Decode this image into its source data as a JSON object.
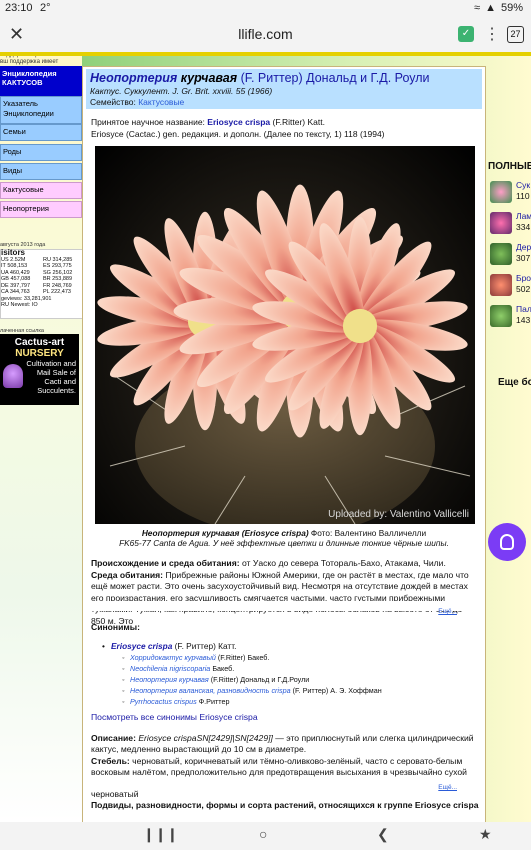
{
  "status": {
    "time": "23:10",
    "temp": "2°",
    "battery": "59%"
  },
  "browser": {
    "url": "llifle.com",
    "tab_count": "27",
    "close_icon": "close-icon",
    "menu_icon": "more-vert-icon"
  },
  "sidebar": {
    "support_text": "поддержка проекта Сеть ЕС вш поддержка имеет решающее",
    "encyclopedia": "Энциклопедия КАКТУСОВ",
    "nav": [
      {
        "label": "Указатель Энциклопедии",
        "style": "blue"
      },
      {
        "label": "Семьи",
        "style": "blue"
      },
      {
        "label": "Роды",
        "style": "blue"
      },
      {
        "label": "Виды",
        "style": "blue"
      },
      {
        "label": "Кактусовые",
        "style": "pink"
      },
      {
        "label": "Неопортерия",
        "style": "pink"
      }
    ],
    "visits_date": "августа 2013 года",
    "visitors_title": "isitors",
    "visitor_rows": [
      [
        "US 2.52M",
        "RU 314,285"
      ],
      [
        "IT 508,153",
        "ES 293,775"
      ],
      [
        "UA 460,429",
        "SG 256,102"
      ],
      [
        "GB 457,088",
        "BR 253,889"
      ],
      [
        "DE 397,797",
        "FR 248,769"
      ],
      [
        "CA 344,763",
        "PL 222,473"
      ]
    ],
    "pageviews": "geviews: 33,281,901",
    "flags_line": "RU  Newest:  IO",
    "ad_label": "лаченная ссылка",
    "ad": {
      "line1": "Cactus-art",
      "line2": "NURSERY",
      "line3": "Cultivation and Mail Sale of Cacti and Succulents."
    }
  },
  "article": {
    "title_genus": "Неопортерия",
    "title_species": "курчавая",
    "title_authority": "(F. Риттер) Дональд и Г.Д. Роули",
    "subtitle": "Кактус. Суккулент. J. Gr. Brit. xxviii. 55 (1966)",
    "family_label": "Семейство:",
    "family_link": "Кактусовые",
    "accepted_label": "Принятое научное название:",
    "accepted_name": "Eriosyce crispa",
    "accepted_author": "(F.Ritter) Katt.",
    "accepted_ref": "Eriosyce (Cactac.) gen. редакция. и дополн. (Далее по тексту, 1) 118 (1994)",
    "photo_credit": "Uploaded by: Valentino Vallicelli",
    "caption_name": "Неопортерия курчавая (Eriosyce crispa)",
    "caption_photo": "Фото: Валентино Валличелли",
    "caption_line2": "FK65-77 Canta de Agua. У неё эффектные цветки и длинные тонкие чёрные шипы.",
    "origin_label": "Происхождение и среда обитания:",
    "origin_text": "от Уаско до севера Тотораль-Бахо, Атакама, Чили.",
    "habitat_label": "Среда обитания:",
    "habitat_text": "Прибрежные районы Южной Америки, где он растёт в местах, где мало что ещё может расти. Это очень засухоустойчивый вид. Несмотря на отсутствие дождей в местах его произрастания, его засушливость смягчается частыми, часто густыми прибрежными туманами. Туман, как правило, концентрируется в виде полосы облаков на высоте от 500 до 850 м. Это",
    "more_label": "Ещё...",
    "synonyms_label": "Синонимы:",
    "synonym_main": "Eriosyce crispa",
    "synonym_main_author": "(F. Риттер) Катт.",
    "sub_synonyms": [
      {
        "name": "Хорридокактус курчавый",
        "author": "(F.Ritter) Бакеб."
      },
      {
        "name": "Neochilenia nigriscoparia",
        "author": "Бакеб."
      },
      {
        "name": "Неопортерия курчавая",
        "author": "(F.Ritter) Дональд и Г.Д.Роули"
      },
      {
        "name": "Неопортерия валанская, разновидность crispa",
        "author": "(F. Риттер) А. Э. Хоффман"
      },
      {
        "name": "Pyrrhocactus crispus",
        "author": "Ф.Риттер"
      }
    ],
    "all_synonyms_link": "Посмотреть все синонимы Eriosyce crispa",
    "desc_label": "Описание:",
    "desc_name": "Eriosyce crispaSN[2429]|SN[2429]]",
    "desc_text": "— это приплюснутый или слегка цилиндрический кактус, медленно вырастающий до 10 см в диаметре.",
    "stem_label": "Стебель:",
    "stem_text": "черноватый, коричневатый или тёмно-оливково-зелёный, часто с серовато-белым восковым налётом, предположительно для предотвращения высыхания в чрезвычайно сухой среде. При выращивании белый восковой налёт часто не образуется, стебель коричневатый/черноватый",
    "subspecies_heading": "Подвиды, разновидности, формы и сорта растений, относящихся к группе Eriosyce crispa"
  },
  "rightcol": {
    "title": "ПОЛНЫЕ",
    "items": [
      {
        "name": "Сук",
        "count": "110"
      },
      {
        "name": "Лам",
        "count": "334"
      },
      {
        "name": "Дер",
        "count": "307"
      },
      {
        "name": "Бро",
        "count": "502"
      },
      {
        "name": "Пал",
        "count": "143"
      }
    ],
    "more": "Еще бо"
  },
  "colors": {
    "accent_blue": "#1a1aa6",
    "link_blue": "#2a5bd7",
    "header_blue": "#b9e0ff",
    "nav_blue": "#99ccff",
    "nav_pink": "#ffccff",
    "assistant": "#7b3cf5"
  }
}
